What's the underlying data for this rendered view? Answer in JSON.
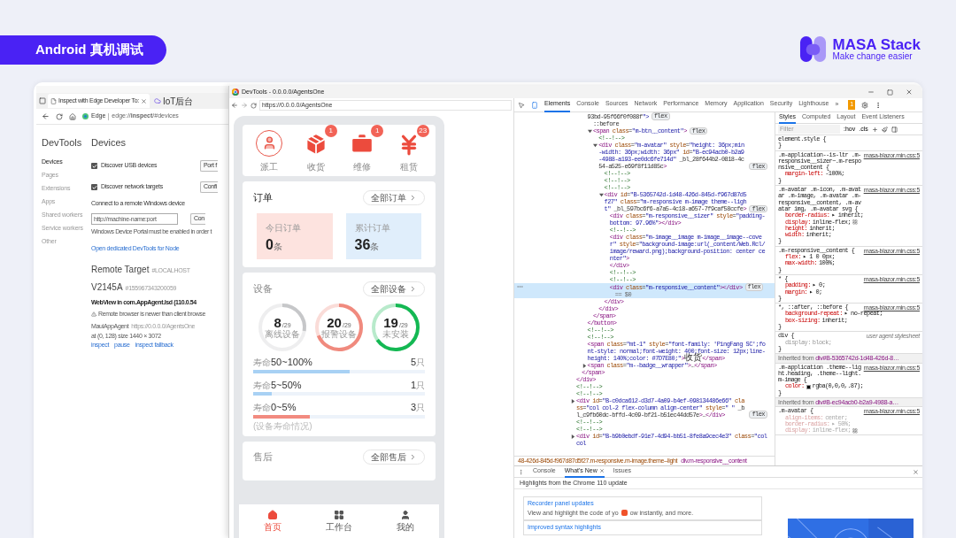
{
  "slide_title": "Android 真机调试",
  "brand": {
    "name": "MASA Stack",
    "tagline": "Make change easier"
  },
  "edge": {
    "tabs": [
      {
        "label": "Inspect with Edge Developer To:",
        "selected": true
      },
      {
        "label": "IoT后台",
        "selected": false
      }
    ],
    "browser": "Edge",
    "url": "edge://**inspect**/#devices",
    "sidebar": {
      "title": "DevTools",
      "items": [
        {
          "label": "Devices",
          "selected": true
        },
        {
          "label": "Pages",
          "selected": false
        },
        {
          "label": "Extensions",
          "selected": false
        },
        {
          "label": "Apps",
          "selected": false
        },
        {
          "label": "Shared workers",
          "selected": false
        },
        {
          "label": "Service workers",
          "selected": false
        },
        {
          "label": "Other",
          "selected": false
        }
      ]
    },
    "devices": {
      "title": "Devices",
      "options": [
        {
          "label": "Discover USB devices",
          "checked": true,
          "button": "Port f"
        },
        {
          "label": "Discover network targets",
          "checked": true,
          "button": "Confi"
        }
      ],
      "remote_label": "Connect to a remote Windows device",
      "address_placeholder": "http://machine-name:port",
      "connect_button": "Con",
      "portal_note": "Windows Device Portal must be enabled in order t",
      "node_link": "Open dedicated DevTools for Node"
    },
    "remote_target": {
      "title": "Remote Target",
      "host": "#LOCALHOST",
      "device": "V2145A",
      "serial": "#155967343200059",
      "webview": "WebView in com.AppAgent.lsd (110.0.54",
      "warning": "Remote browser is newer than client browse",
      "app": "MauiAppAgent",
      "app_url": "https://0.0.0.0/AgentsOne",
      "geometry": "at (0, 128)  size 1440 × 3072",
      "actions": [
        "inspect",
        "pause",
        "inspect fallback"
      ]
    }
  },
  "devtools_window": {
    "title": "DevTools - 0.0.0.0/AgentsOne",
    "url": "https://0.0.0.0/AgentsOne"
  },
  "app": {
    "shortcuts": [
      {
        "label": "派工",
        "kind": "avatar"
      },
      {
        "label": "收货",
        "kind": "box",
        "badge": "1"
      },
      {
        "label": "维修",
        "kind": "toolbox",
        "badge": "1"
      },
      {
        "label": "租赁",
        "kind": "yen",
        "badge": "23"
      }
    ],
    "orders": {
      "title": "订单",
      "button": "全部订单",
      "tiles": [
        {
          "label": "今日订单",
          "value": "0",
          "unit": "条",
          "color": "#fde3df"
        },
        {
          "label": "累计订单",
          "value": "36",
          "unit": "条",
          "color": "#e0eefb"
        }
      ]
    },
    "devices": {
      "title": "设备",
      "button": "全部设备",
      "rings": [
        {
          "value": "8",
          "total": "/29",
          "label": "离线设备",
          "color": "#c6c7c9"
        },
        {
          "value": "20",
          "total": "/29",
          "label": "报警设备",
          "color": "#f08a7e"
        },
        {
          "value": "19",
          "total": "/29",
          "label": "未安装",
          "color": "#14b853"
        }
      ],
      "lifespans": [
        {
          "prefix": "寿命",
          "range": "50~100%",
          "count": "5",
          "unit": "只",
          "level": 0.56,
          "color": "#a8d1f4"
        },
        {
          "prefix": "寿命",
          "range": "5~50%",
          "count": "1",
          "unit": "只",
          "level": 0.11,
          "color": "#a8d1f4"
        },
        {
          "prefix": "寿命",
          "range": "0~5%",
          "count": "3",
          "unit": "只",
          "level": 0.33,
          "color": "#f28b80"
        }
      ],
      "note": "(设备寿命情况)"
    },
    "after_sales": {
      "title": "售后",
      "button": "全部售后"
    },
    "nav": [
      {
        "label": "首页",
        "kind": "home",
        "selected": true
      },
      {
        "label": "工作台",
        "kind": "grid",
        "selected": false
      },
      {
        "label": "我的",
        "kind": "person",
        "selected": false
      }
    ]
  },
  "devtools": {
    "tabs": [
      {
        "label": "Elements",
        "selected": true
      },
      {
        "label": "Console",
        "selected": false
      },
      {
        "label": "Sources",
        "selected": false
      },
      {
        "label": "Network",
        "selected": false
      },
      {
        "label": "Performance",
        "selected": false
      },
      {
        "label": "Memory",
        "selected": false
      },
      {
        "label": "Application",
        "selected": false
      },
      {
        "label": "Security",
        "selected": false
      },
      {
        "label": "Lighthouse",
        "selected": false
      }
    ],
    "more": "»",
    "issues": "1",
    "tree": [
      {
        "close": "</div>",
        "children": [
          {
            "close": "</span>",
            "children": [
              {
                "text": "93bd-95f66f0f088f\">",
                "flex": "flex",
                "selected": false,
                "close": "</button>",
                "children": [
                  {
                    "text": "::before",
                    "selected": false
                  },
                  {
                    "text": "<span class=\"m-btn__content\">",
                    "flex": "flex",
                    "expanded": true,
                    "selected": false,
                    "close": "</span>",
                    "children": [
                      {
                        "text": "<!--!-->",
                        "selected": false
                      },
                      {
                        "text": "<div class=\"m-avatar\" style=\"height: 36px;min-width: 36px;width: 36px\" id=\"B-ec94acb0-b2a9-4988-a193-ee0dc6fe714d\" _bl_28f644b2-0818-4c54-a525-e69f8f11d85c>",
                        "flex": "flex",
                        "expanded": true,
                        "selected": false,
                        "close": "</div>",
                        "children": [
                          {
                            "text": "<!--!-->",
                            "selected": false
                          },
                          {
                            "text": "<!--!-->",
                            "selected": false
                          },
                          {
                            "text": "<!--!-->",
                            "selected": false
                          },
                          {
                            "text": "<div id=\"B-5365742d-1d48-426d-845d-f967d87d5f27\" class=\"m-responsive m-image theme--light\" _bl_597bc6f6-a7a5-4c18-a657-7f9caf58ccfe>",
                            "flex": "flex",
                            "expanded": true,
                            "selected": false,
                            "close": "</div>",
                            "children": [
                              {
                                "text": "<div class=\"m-responsive__sizer\" style=\"padding-bottom: 97.96%\"></div>",
                                "selected": false
                              },
                              {
                                "text": "<!--!-->",
                                "selected": false
                              },
                              {
                                "text": "<div class=\"m-image__image m-image__image--cover\" style=\"background-image:url(_content/Web.Rcl/image/reward.png);background-position: center center\">",
                                "selected": false,
                                "close": "</div>"
                              },
                              {
                                "text": "<!--!-->",
                                "selected": false
                              },
                              {
                                "text": "<!--!-->",
                                "selected": false
                              },
                              {
                                "text": "<div class=\"m-responsive__content\"></div>",
                                "flex": "flex",
                                "suffix": "== $0",
                                "selected": true
                              }
                            ]
                          }
                        ]
                      }
                    ]
                  }
                ]
              },
              {
                "text": "<!--!-->",
                "selected": false
              },
              {
                "text": "<!--!-->",
                "selected": false
              },
              {
                "text": "<span class=\"mt-1\" style=\"font-family: 'PingFang SC';font-style: normal;font-weight: 400;font-size: 12px;line-height: 140%;color: #7D7E80;\">收货</span>",
                "selected": false
              },
              {
                "text": "<span class=\"m--badge__wrapper\">…</span>",
                "expanded": false,
                "selected": false
              }
            ]
          }
        ]
      },
      {
        "text": "<!--!-->",
        "selected": false
      },
      {
        "text": "<!--!-->",
        "selected": false
      },
      {
        "text": "<div id=\"B-c0dca612-d3d7-4a09-b4ef-098134486e66\" class=\"col col-2 flex-column align-center\" style=\" \" _bl_c9fb60dc-bffd-4c09-bf21-b51ec44dd57e>…</div>",
        "flex": "flex",
        "expanded": false,
        "selected": false
      },
      {
        "text": "<!--!-->",
        "selected": false
      },
      {
        "text": "<!--!-->",
        "selected": false
      },
      {
        "text": "<div id=\"B-b9b0ebdf-91e7-4d94-bb51-8fe8a9cec4e3\" class=\"col col",
        "expanded": false,
        "selected": false
      }
    ],
    "breadcrumbs": [
      "48-426d-845d-f967d87d5f27.m-responsive.m-image.theme--light",
      "div.m-responsive__content"
    ],
    "styles_tabs": [
      {
        "label": "Styles",
        "selected": true
      },
      {
        "label": "Computed",
        "selected": false
      },
      {
        "label": "Layout",
        "selected": false
      },
      {
        "label": "Event Listeners",
        "selected": false
      }
    ],
    "filter_placeholder": "Filter",
    "hov": ":hov",
    "cls": ".cls",
    "rules": [
      {
        "kind": "rule",
        "selector": "element.style {",
        "close": "}"
      },
      {
        "kind": "rule",
        "selector": ".m-application--is-ltr .m-responsive__sizer~.m-responsive__content {",
        "source": "masa-blazor.min.css:5",
        "agent": false,
        "close": "}",
        "decls": [
          {
            "prop": "margin-left:",
            "value": "-100%;",
            "kind": "normal"
          }
        ]
      },
      {
        "kind": "rule",
        "selector": ".m-avatar .m-icon, .m-avatar .m-image, .m-avatar .m-responsive__content, .m-avatar img, .m-avatar svg {",
        "source": "masa-blazor.min.css:5",
        "agent": false,
        "close": "}",
        "decls": [
          {
            "prop": "border-radius:",
            "value": "▸ inherit;",
            "kind": "normal"
          },
          {
            "prop": "display:",
            "value": "inline-flex;",
            "kind": "normal",
            "flex_editor": true
          },
          {
            "prop": "height:",
            "value": "inherit;",
            "kind": "normal"
          },
          {
            "prop": "width:",
            "value": "inherit;",
            "kind": "normal"
          }
        ]
      },
      {
        "kind": "rule",
        "selector": ".m-responsive__content {",
        "source": "masa-blazor.min.css:5",
        "agent": false,
        "close": "}",
        "decls": [
          {
            "prop": "flex:",
            "value": "▸ 1 0 0px;",
            "kind": "normal"
          },
          {
            "prop": "max-width:",
            "value": "100%;",
            "kind": "normal"
          }
        ]
      },
      {
        "kind": "rule",
        "selector": "* {",
        "source": "masa-blazor.min.css:5",
        "agent": false,
        "close": "}",
        "decls": [
          {
            "prop": "padding:",
            "value": "▸ 0;",
            "kind": "normal"
          },
          {
            "prop": "margin:",
            "value": "▸ 0;",
            "kind": "normal"
          }
        ]
      },
      {
        "kind": "rule",
        "selector": "*, ::after, ::before {",
        "source": "masa-blazor.min.css:5",
        "agent": false,
        "close": "}",
        "decls": [
          {
            "prop": "background-repeat:",
            "value": "▸ no-repeat;",
            "kind": "normal"
          },
          {
            "prop": "box-sizing:",
            "value": "inherit;",
            "kind": "normal"
          }
        ]
      },
      {
        "kind": "rule",
        "selector": "div {",
        "source": "user agent stylesheet",
        "agent": true,
        "close": "}",
        "decls": [
          {
            "prop": "display:",
            "value": "block;",
            "kind": "overridden"
          }
        ]
      },
      {
        "kind": "inherited",
        "label": "Inherited from",
        "node": "div#B-5365742d-1d48-426d-8…"
      },
      {
        "kind": "rule",
        "selector": ".m-application .theme--light.heading, .theme--light.m-image {",
        "source": "masa-blazor.min.css:5",
        "agent": false,
        "close": "}",
        "decls": [
          {
            "prop": "color:",
            "value": "rgba(0,0,0,.87);",
            "kind": "normal",
            "color": "#000000"
          }
        ]
      },
      {
        "kind": "inherited",
        "label": "Inherited from",
        "node": "div#B-ec94acb0-b2a9-4988-a…"
      },
      {
        "kind": "rule",
        "selector": ".m-avatar {",
        "source": "masa-blazor.min.css:5",
        "agent": false,
        "decls": [
          {
            "prop": "align-items:",
            "value": "center;",
            "kind": "inactive"
          },
          {
            "prop": "border-radius:",
            "value": "▸ 50%;",
            "kind": "inactive"
          },
          {
            "prop": "display:",
            "value": "inline-flex;",
            "kind": "inactive",
            "flex_editor": true
          }
        ]
      }
    ],
    "drawer": {
      "tabs": [
        {
          "label": "Console",
          "selected": false
        },
        {
          "label": "What's New",
          "selected": true
        },
        {
          "label": "Issues",
          "selected": false
        }
      ],
      "heading": "Highlights from the Chrome 110 update",
      "cards": [
        {
          "title": "Recorder panel updates",
          "text_before": "View and highlight the code of yo",
          "text_after": "ow instantly, and more."
        },
        {
          "title": "Improved syntax highlights"
        }
      ]
    }
  }
}
